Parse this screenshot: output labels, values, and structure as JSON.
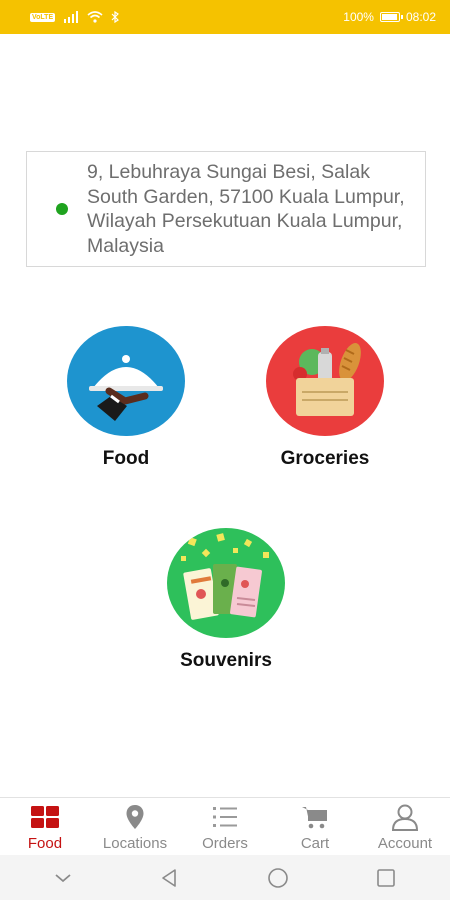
{
  "status_bar": {
    "badge": "VoLTE",
    "battery_text": "100%",
    "battery_level": 1.0,
    "time": "08:02"
  },
  "address": {
    "text": "9, Lebuhraya Sungai Besi, Salak South Garden, 57100 Kuala Lumpur, Wilayah Persekutuan Kuala Lumpur, Malaysia"
  },
  "categories": [
    {
      "label": "Food",
      "icon": "food-serving-icon",
      "color": "#1e94cf"
    },
    {
      "label": "Groceries",
      "icon": "grocery-bag-icon",
      "color": "#ea3d3d"
    },
    {
      "label": "Souvenirs",
      "icon": "souvenirs-icon",
      "color": "#2ec05b"
    }
  ],
  "bottom_nav": {
    "items": [
      {
        "label": "Food",
        "icon": "grid-icon",
        "active": true
      },
      {
        "label": "Locations",
        "icon": "location-pin-icon",
        "active": false
      },
      {
        "label": "Orders",
        "icon": "list-icon",
        "active": false
      },
      {
        "label": "Cart",
        "icon": "cart-icon",
        "active": false
      },
      {
        "label": "Account",
        "icon": "user-icon",
        "active": false
      }
    ]
  },
  "colors": {
    "status_bar": "#f5c200",
    "accent": "#c51212",
    "location_dot": "#1fa31f"
  }
}
